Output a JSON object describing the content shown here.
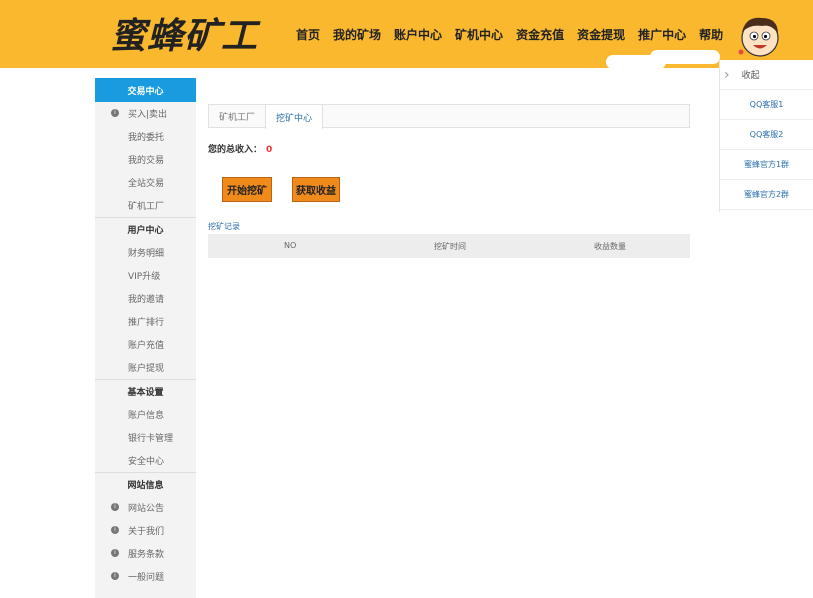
{
  "header": {
    "logo_text_1": "蜜蜂",
    "logo_text_2": "矿工",
    "nav": [
      "首页",
      "我的矿场",
      "账户中心",
      "矿机中心",
      "资金充值",
      "资金提现",
      "推广中心",
      "帮助"
    ],
    "bg_color": "#f9b82e"
  },
  "side_panel": {
    "collapse_label": "收起",
    "items": [
      "QQ客服1",
      "QQ客服2",
      "蜜蜂官方1群",
      "蜜蜂官方2群"
    ]
  },
  "sidebar": {
    "active_title": "交易中心",
    "trade_items": [
      "买入|卖出",
      "我的委托",
      "我的交易",
      "全站交易",
      "矿机工厂"
    ],
    "user_title": "用户中心",
    "user_items": [
      "财务明细",
      "VIP升级",
      "我的邀请",
      "推广排行",
      "账户充值",
      "账户提现"
    ],
    "settings_title": "基本设置",
    "settings_items": [
      "账户信息",
      "银行卡管理",
      "安全中心"
    ],
    "site_title": "网站信息",
    "site_items": [
      "网站公告",
      "关于我们",
      "服务条款",
      "一般问题"
    ]
  },
  "main": {
    "tabs": [
      "矿机工厂",
      "挖矿中心"
    ],
    "total_label": "您的总收入：",
    "total_value": "0",
    "start_button": "开始挖矿",
    "collect_button": "获取收益",
    "records_label": "挖矿记录",
    "table_headers": [
      "NO",
      "挖矿时间",
      "收益数量"
    ]
  }
}
